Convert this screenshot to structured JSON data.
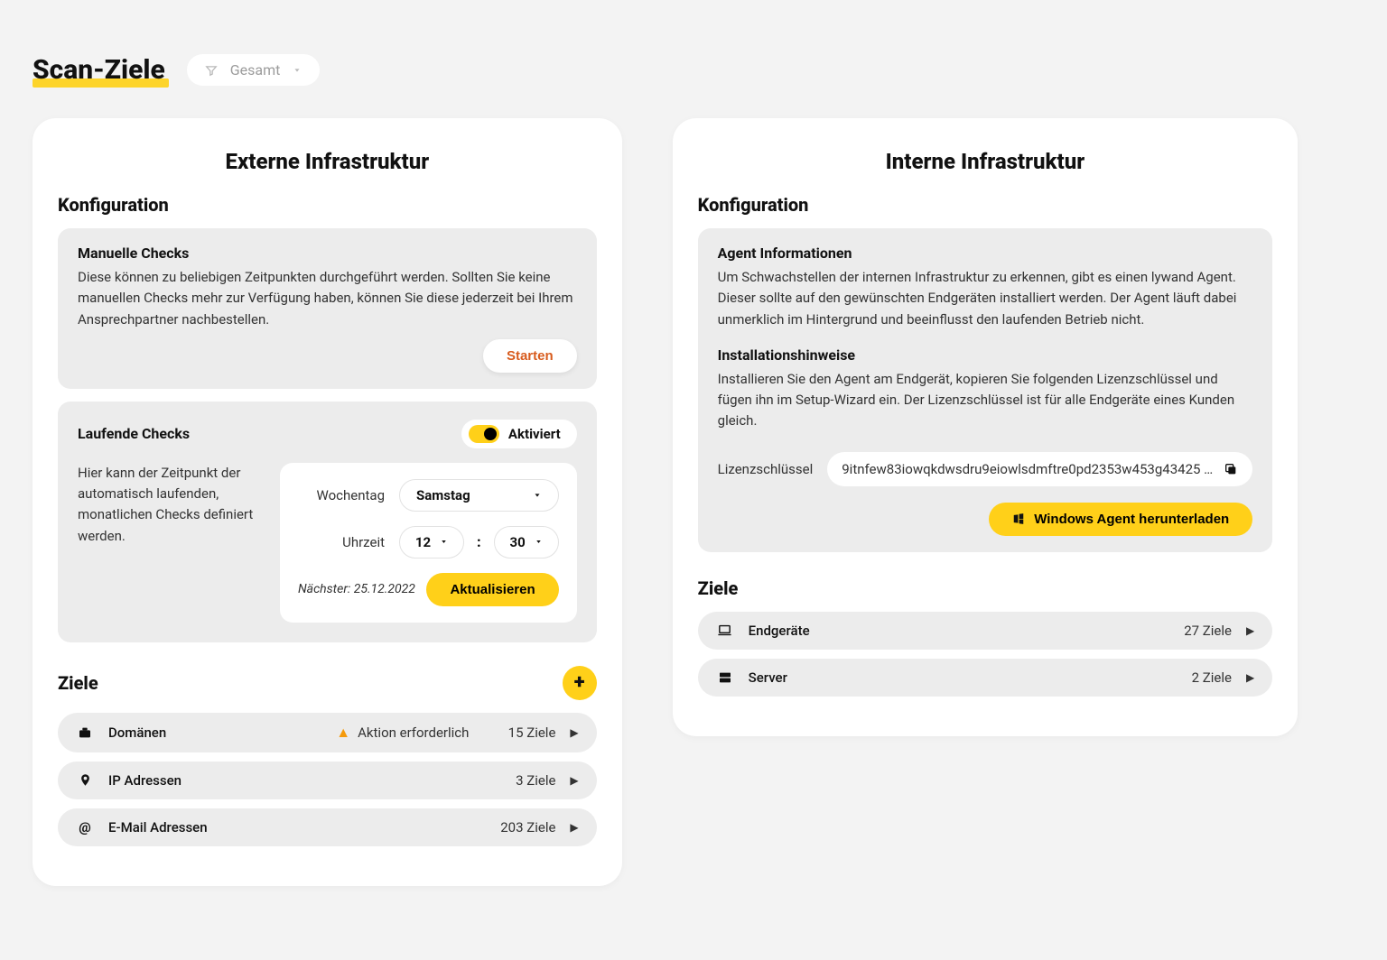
{
  "header": {
    "title": "Scan-Ziele",
    "filter_label": "Gesamt"
  },
  "external": {
    "title": "Externe Infrastruktur",
    "config_title": "Konfiguration",
    "manual": {
      "heading": "Manuelle Checks",
      "text": "Diese können zu beliebigen Zeitpunkten durchgeführt werden. Sollten Sie keine manuellen Checks mehr zur Verfügung haben, können Sie diese jederzeit bei Ihrem Ansprechpartner nachbestellen.",
      "start_button": "Starten"
    },
    "running": {
      "heading": "Laufende Checks",
      "activated_label": "Aktiviert",
      "description": "Hier kann der Zeitpunkt der automatisch laufenden, monatlichen Checks definiert werden.",
      "weekday_label": "Wochentag",
      "weekday_value": "Samstag",
      "time_label": "Uhrzeit",
      "hour_value": "12",
      "minute_value": "30",
      "next_label": "Nächster: 25.12.2022",
      "update_button": "Aktualisieren"
    },
    "targets": {
      "title": "Ziele",
      "rows": [
        {
          "label": "Domänen",
          "warning": "Aktion erforderlich",
          "count": "15 Ziele"
        },
        {
          "label": "IP Adressen",
          "count": "3 Ziele"
        },
        {
          "label": "E-Mail Adressen",
          "count": "203 Ziele"
        }
      ]
    }
  },
  "internal": {
    "title": "Interne Infrastruktur",
    "config_title": "Konfiguration",
    "agent_info": {
      "heading": "Agent Informationen",
      "text": "Um Schwachstellen der internen Infrastruktur zu erkennen, gibt es einen lywand Agent. Dieser sollte auf den gewünschten Endgeräten installiert werden. Der Agent läuft dabei unmerklich im Hintergrund und beeinflusst den laufenden Betrieb nicht."
    },
    "install_info": {
      "heading": "Installationshinweise",
      "text": "Installieren Sie den Agent am Endgerät, kopieren Sie folgenden Lizenzschlüssel und fügen ihn im Setup-Wizard ein. Der Lizenzschlüssel ist für alle Endgeräte eines Kunden gleich."
    },
    "license": {
      "label": "Lizenzschlüssel",
      "value": "9itnfew83iowqkdwsdru9eiowlsdmftre0pd2353w453g43425 …"
    },
    "download_button": "Windows Agent herunterladen",
    "targets": {
      "title": "Ziele",
      "rows": [
        {
          "label": "Endgeräte",
          "count": "27 Ziele"
        },
        {
          "label": "Server",
          "count": "2 Ziele"
        }
      ]
    }
  }
}
